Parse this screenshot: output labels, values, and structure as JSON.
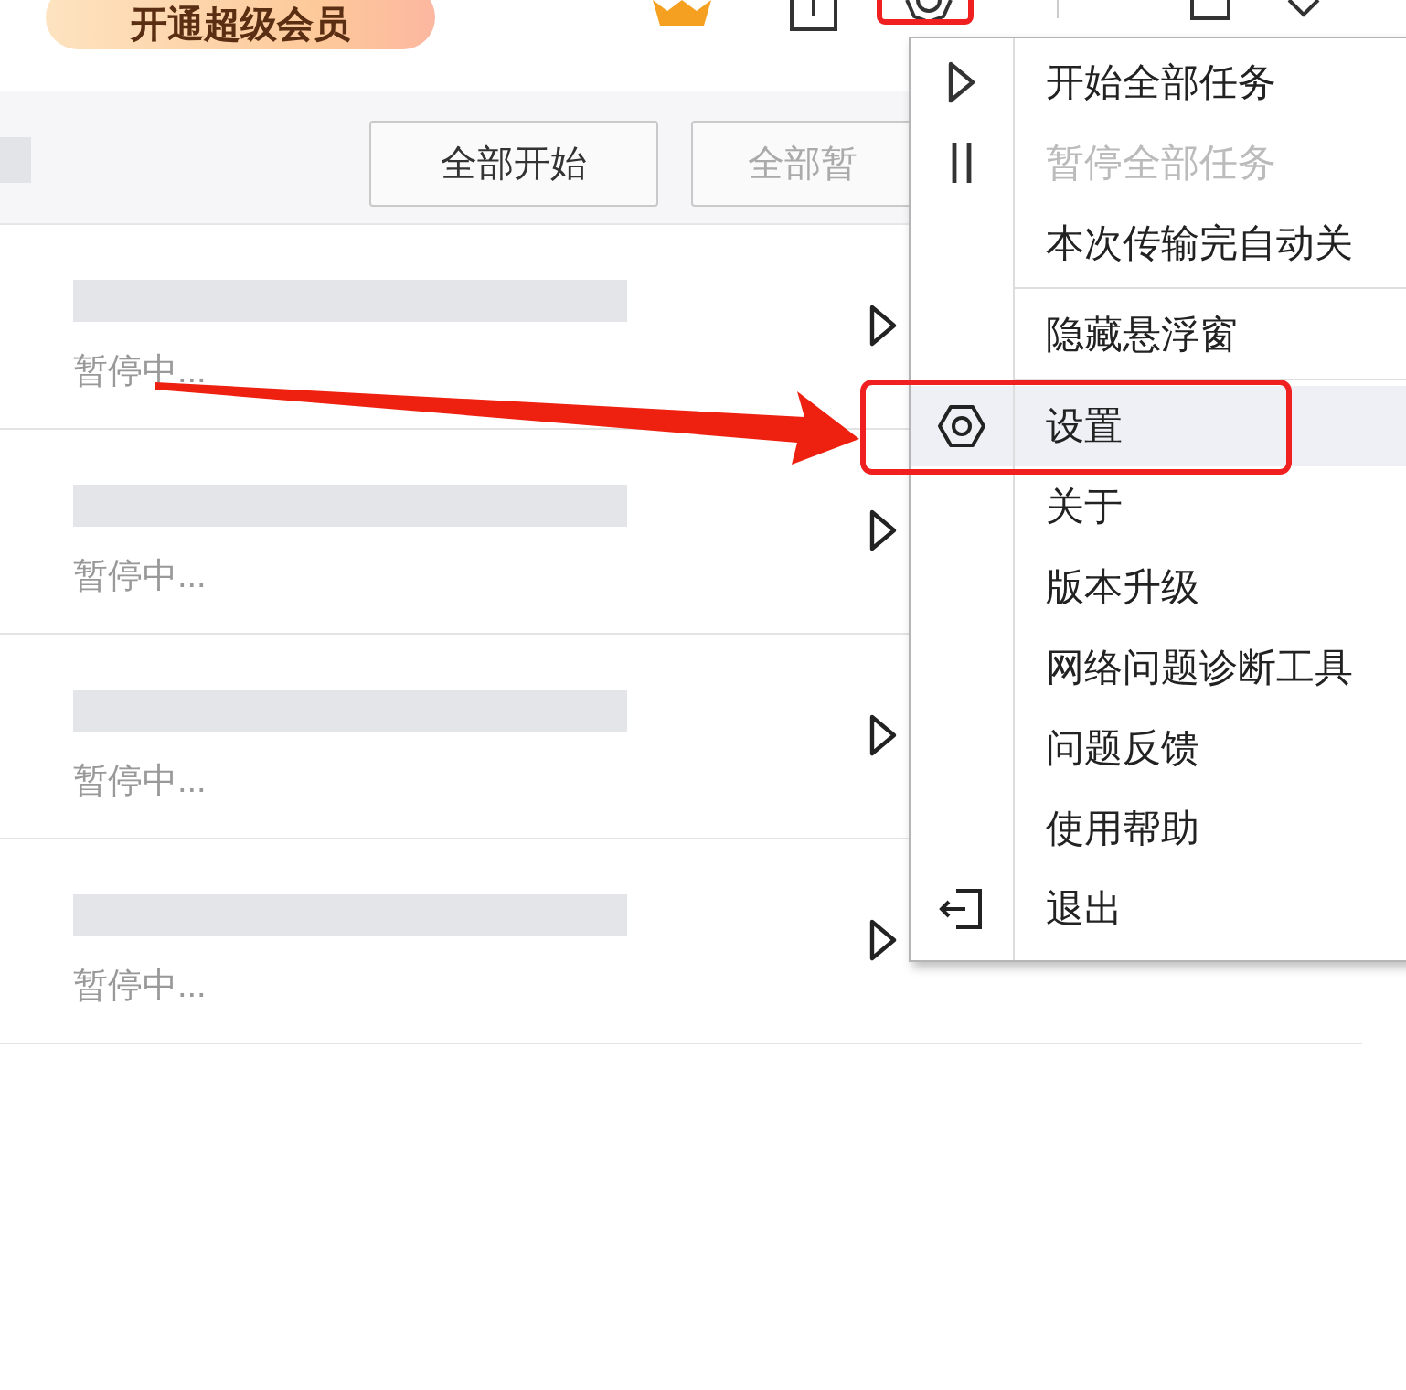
{
  "header": {
    "vip_button": "开通超级会员"
  },
  "toolbar": {
    "buttons": [
      {
        "label": "全部开始",
        "disabled": false
      },
      {
        "label": "全部暂",
        "disabled": true
      }
    ]
  },
  "tasks": [
    {
      "status": "暂停中..."
    },
    {
      "status": "暂停中..."
    },
    {
      "status": "暂停中..."
    },
    {
      "status": "暂停中..."
    }
  ],
  "menu": {
    "groups": [
      [
        {
          "label": "开始全部任务",
          "kind": "play",
          "disabled": false,
          "selected": false
        },
        {
          "label": "暂停全部任务",
          "kind": "pause",
          "disabled": true,
          "selected": false
        },
        {
          "label": "本次传输完自动关",
          "kind": "none",
          "disabled": false,
          "selected": false
        }
      ],
      [
        {
          "label": "隐藏悬浮窗",
          "kind": "none",
          "disabled": false,
          "selected": false
        }
      ],
      [
        {
          "label": "设置",
          "kind": "settings",
          "disabled": false,
          "selected": true
        },
        {
          "label": "关于",
          "kind": "none",
          "disabled": false,
          "selected": false
        },
        {
          "label": "版本升级",
          "kind": "none",
          "disabled": false,
          "selected": false
        },
        {
          "label": "网络问题诊断工具",
          "kind": "none",
          "disabled": false,
          "selected": false
        },
        {
          "label": "问题反馈",
          "kind": "none",
          "disabled": false,
          "selected": false
        },
        {
          "label": "使用帮助",
          "kind": "none",
          "disabled": false,
          "selected": false
        },
        {
          "label": "退出",
          "kind": "exit",
          "disabled": false,
          "selected": false
        }
      ]
    ]
  }
}
